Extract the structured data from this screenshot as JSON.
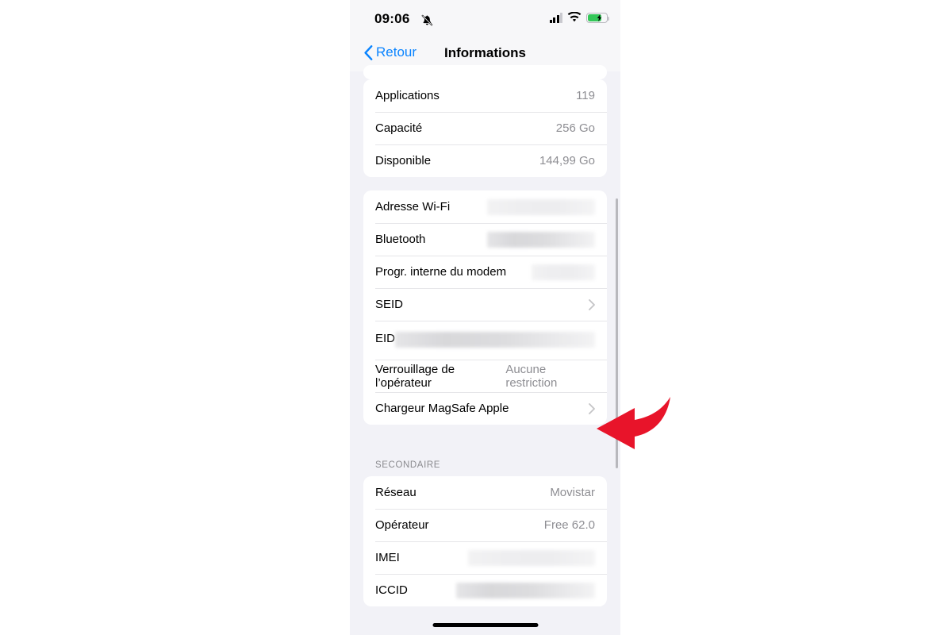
{
  "status_bar": {
    "time": "09:06",
    "silent_icon": "bell-slash-icon",
    "cellular_icon": "cellular-signal-icon",
    "wifi_icon": "wifi-icon",
    "battery_icon": "battery-charging-icon",
    "battery_color": "#34c759"
  },
  "nav": {
    "back_label": "Retour",
    "back_icon": "chevron-left-icon",
    "title": "Informations",
    "accent_color": "#0a84ff"
  },
  "storage_group": {
    "rows": [
      {
        "label": "Applications",
        "value": "119"
      },
      {
        "label": "Capacité",
        "value": "256 Go"
      },
      {
        "label": "Disponible",
        "value": "144,99 Go"
      }
    ]
  },
  "device_group": {
    "rows": [
      {
        "label": "Adresse Wi-Fi",
        "value": "",
        "redacted": true,
        "redact_style": "light",
        "redact_width": 136
      },
      {
        "label": "Bluetooth",
        "value": "",
        "redacted": true,
        "redact_style": "dark",
        "redact_width": 136
      },
      {
        "label": "Progr. interne du modem",
        "value": "",
        "redacted": true,
        "redact_style": "light",
        "redact_width": 80
      },
      {
        "label": "SEID",
        "value": "",
        "disclosure": true
      },
      {
        "label": "EID",
        "value": "",
        "redacted": true,
        "stacked": true,
        "redact_style": "dark"
      },
      {
        "label": "Verrouillage de l’opérateur",
        "value": "Aucune restriction"
      },
      {
        "label": "Chargeur MagSafe Apple",
        "value": "",
        "disclosure": true,
        "highlighted": true
      }
    ]
  },
  "secondary_group": {
    "header": "SECONDAIRE",
    "rows": [
      {
        "label": "Réseau",
        "value": "Movistar"
      },
      {
        "label": "Opérateur",
        "value": "Free 62.0"
      },
      {
        "label": "IMEI",
        "value": "",
        "redacted": true,
        "redact_style": "light",
        "redact_width": 160
      },
      {
        "label": "ICCID",
        "value": "",
        "redacted": true,
        "redact_style": "dark",
        "redact_width": 175
      }
    ]
  },
  "annotation": {
    "arrow_icon": "curved-red-arrow-icon",
    "arrow_color": "#e8142a",
    "points_at": "Chargeur MagSafe Apple"
  },
  "home_indicator": "home-indicator"
}
